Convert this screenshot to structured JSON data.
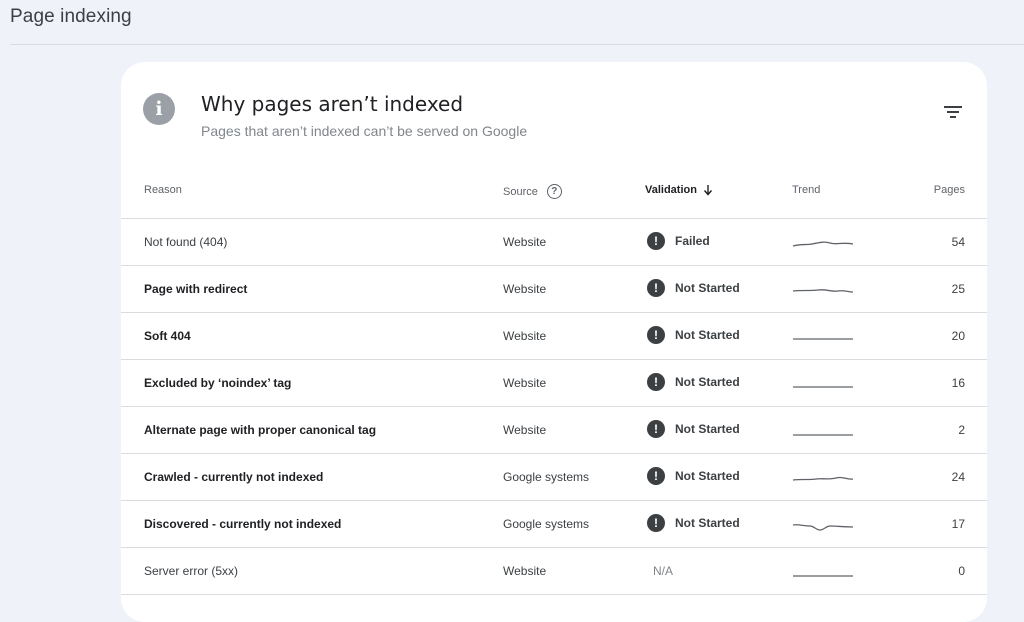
{
  "page": {
    "title": "Page indexing"
  },
  "card": {
    "title": "Why pages aren’t indexed",
    "subtitle": "Pages that aren’t indexed can’t be served on Google",
    "info_icon": "info-icon",
    "filter_icon": "filter-icon"
  },
  "table": {
    "headers": {
      "reason": "Reason",
      "source": "Source",
      "validation": "Validation",
      "trend": "Trend",
      "pages": "Pages"
    },
    "rows": [
      {
        "reason": "Not found (404)",
        "source": "Website",
        "validation": "Failed",
        "pages": "54"
      },
      {
        "reason": "Page with redirect",
        "source": "Website",
        "validation": "Not Started",
        "pages": "25"
      },
      {
        "reason": "Soft 404",
        "source": "Website",
        "validation": "Not Started",
        "pages": "20"
      },
      {
        "reason": "Excluded by ‘noindex’ tag",
        "source": "Website",
        "validation": "Not Started",
        "pages": "16"
      },
      {
        "reason": "Alternate page with proper canonical tag",
        "source": "Website",
        "validation": "Not Started",
        "pages": "2"
      },
      {
        "reason": "Crawled - currently not indexed",
        "source": "Google systems",
        "validation": "Not Started",
        "pages": "24"
      },
      {
        "reason": "Discovered - currently not indexed",
        "source": "Google systems",
        "validation": "Not Started",
        "pages": "17"
      },
      {
        "reason": "Server error (5xx)",
        "source": "Website",
        "validation": "N/A",
        "pages": "0"
      }
    ]
  }
}
